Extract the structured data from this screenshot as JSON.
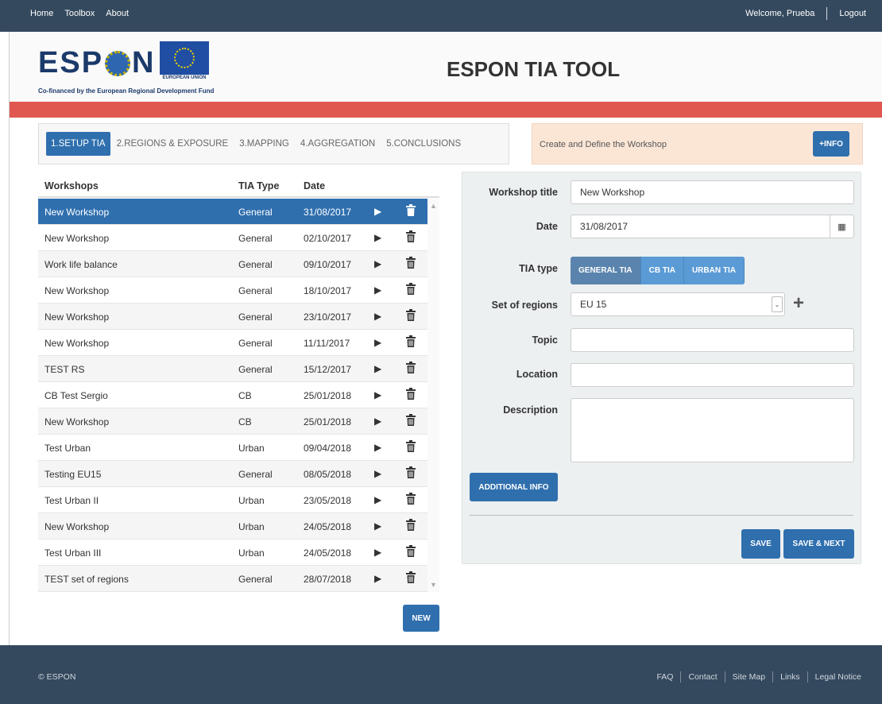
{
  "topnav": {
    "home": "Home",
    "toolbox": "Toolbox",
    "about": "About",
    "welcome": "Welcome, Prueba",
    "logout": "Logout"
  },
  "header": {
    "logo_text": "ESPON",
    "eu_label": "EUROPEAN UNION",
    "cofinanced": "Co-financed by the European Regional Development Fund",
    "title": "ESPON TIA TOOL"
  },
  "steps": [
    {
      "label": "1.SETUP TIA",
      "active": true
    },
    {
      "label": "2.REGIONS & EXPOSURE",
      "active": false
    },
    {
      "label": "3.MAPPING",
      "active": false
    },
    {
      "label": "4.AGGREGATION",
      "active": false
    },
    {
      "label": "5.CONCLUSIONS",
      "active": false
    }
  ],
  "info": {
    "text": "Create and Define the Workshop",
    "button": "+INFO"
  },
  "table": {
    "headers": {
      "name": "Workshops",
      "type": "TIA Type",
      "date": "Date"
    },
    "rows": [
      {
        "name": "New Workshop",
        "type": "General",
        "date": "31/08/2017"
      },
      {
        "name": "New Workshop",
        "type": "General",
        "date": "02/10/2017"
      },
      {
        "name": "Work life balance",
        "type": "General",
        "date": "09/10/2017"
      },
      {
        "name": "New Workshop",
        "type": "General",
        "date": "18/10/2017"
      },
      {
        "name": "New Workshop",
        "type": "General",
        "date": "23/10/2017"
      },
      {
        "name": "New Workshop",
        "type": "General",
        "date": "11/11/2017"
      },
      {
        "name": "TEST RS",
        "type": "General",
        "date": "15/12/2017"
      },
      {
        "name": "CB Test Sergio",
        "type": "CB",
        "date": "25/01/2018"
      },
      {
        "name": "New Workshop",
        "type": "CB",
        "date": "25/01/2018"
      },
      {
        "name": "Test Urban",
        "type": "Urban",
        "date": "09/04/2018"
      },
      {
        "name": "Testing EU15",
        "type": "General",
        "date": "08/05/2018"
      },
      {
        "name": "Test Urban II",
        "type": "Urban",
        "date": "23/05/2018"
      },
      {
        "name": "New Workshop",
        "type": "Urban",
        "date": "24/05/2018"
      },
      {
        "name": "Test Urban III",
        "type": "Urban",
        "date": "24/05/2018"
      },
      {
        "name": "TEST set of regions",
        "type": "General",
        "date": "28/07/2018"
      }
    ],
    "selected_index": 0,
    "new_button": "NEW"
  },
  "form": {
    "title_label": "Workshop title",
    "title_value": "New Workshop",
    "date_label": "Date",
    "date_value": "31/08/2017",
    "tia_label": "TIA type",
    "tia_options": [
      "GENERAL TIA",
      "CB TIA",
      "URBAN TIA"
    ],
    "regions_label": "Set of regions",
    "regions_value": "EU 15",
    "topic_label": "Topic",
    "location_label": "Location",
    "description_label": "Description",
    "additional_button": "ADDITIONAL INFO",
    "save_button": "SAVE",
    "save_next_button": "SAVE & NEXT"
  },
  "footer": {
    "copyright": "© ESPON",
    "links": [
      "FAQ",
      "Contact",
      "Site Map",
      "Links",
      "Legal Notice"
    ]
  },
  "colors": {
    "nav": "#34495e",
    "accent": "#2f6fae",
    "red_bar": "#e0574f",
    "info_bg": "#fbe6d6"
  }
}
